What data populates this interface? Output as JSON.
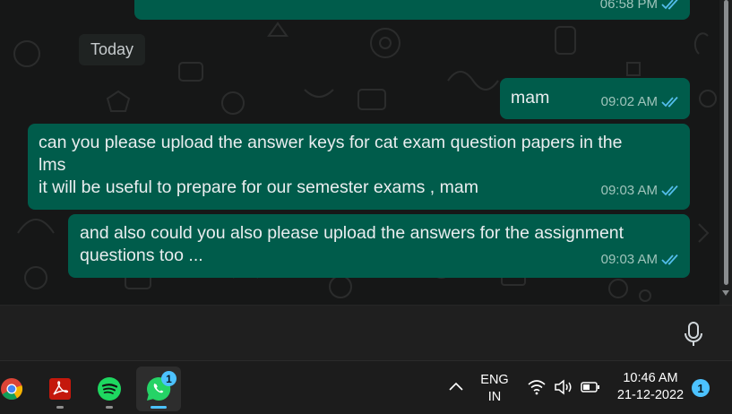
{
  "chat": {
    "date_chip": "Today",
    "messages": [
      {
        "time": "06:58 PM",
        "text": ""
      },
      {
        "time": "09:02 AM",
        "text": "mam"
      },
      {
        "time": "09:03 AM",
        "text": "can you please upload the answer keys for cat exam question papers in the\nlms\nit will be useful to prepare for our semester exams , mam"
      },
      {
        "time": "09:03 AM",
        "text": "and also could you also please upload the answers for the assignment\nquestions too ..."
      }
    ],
    "colors": {
      "bubble": "#005c4b",
      "ticks": "#53bdeb",
      "background": "#161717"
    }
  },
  "compose": {
    "mic_icon": "microphone-icon"
  },
  "taskbar": {
    "apps": [
      {
        "name": "chrome",
        "icon": "chrome-icon"
      },
      {
        "name": "acrobat",
        "icon": "acrobat-icon"
      },
      {
        "name": "spotify",
        "icon": "spotify-icon"
      },
      {
        "name": "whatsapp",
        "icon": "whatsapp-icon",
        "badge": "1"
      }
    ],
    "tray": {
      "language_top": "ENG",
      "language_bottom": "IN",
      "time": "10:46 AM",
      "date": "21-12-2022",
      "notifications": "1"
    }
  }
}
